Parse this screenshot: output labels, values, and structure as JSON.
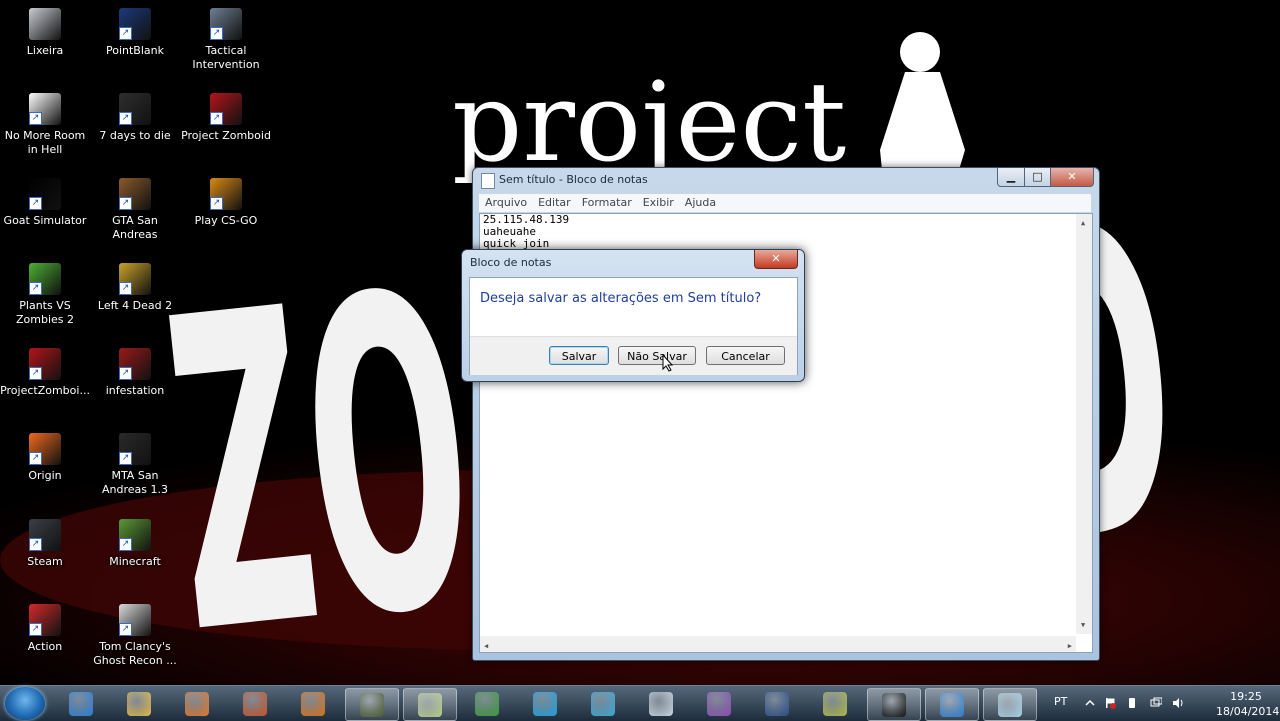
{
  "wallpaper": {
    "logo_top": "project",
    "logo_big": "ZOMBOID"
  },
  "desktop_icons": [
    {
      "label": "Lixeira",
      "icon": "recycle-bin-icon",
      "color": "#c8ccd2"
    },
    {
      "label": "PointBlank",
      "icon": "pointblank-icon",
      "color": "#1d3a7a"
    },
    {
      "label": "Tactical Intervention",
      "icon": "tactical-intervention-icon",
      "color": "#6d7f94"
    },
    {
      "label": "No More Room in Hell",
      "icon": "document-icon",
      "color": "#ffffff"
    },
    {
      "label": "7 days to die",
      "icon": "steam-game-icon",
      "color": "#2e2e2e"
    },
    {
      "label": "Project Zomboid",
      "icon": "project-zomboid-icon",
      "color": "#b3151a"
    },
    {
      "label": "Goat Simulator",
      "icon": "goat-simulator-icon",
      "color": "#000000"
    },
    {
      "label": "GTA San Andreas",
      "icon": "gta-icon",
      "color": "#8a5a2a"
    },
    {
      "label": "Play CS-GO",
      "icon": "csgo-icon",
      "color": "#d88a16"
    },
    {
      "label": "Plants VS Zombies 2",
      "icon": "bluestacks-icon",
      "color": "#4caf34"
    },
    {
      "label": "Left 4 Dead 2",
      "icon": "left4dead-icon",
      "color": "#c9a22a"
    },
    {
      "label": "ProjectZomboi...",
      "icon": "project-zomboid-icon",
      "color": "#b3151a"
    },
    {
      "label": "infestation",
      "icon": "infestation-icon",
      "color": "#9a1a1a"
    },
    {
      "label": "Origin",
      "icon": "origin-icon",
      "color": "#f06a1e"
    },
    {
      "label": "MTA San Andreas 1.3",
      "icon": "mta-icon",
      "color": "#2a2a2a"
    },
    {
      "label": "Steam",
      "icon": "steam-icon",
      "color": "#3a3f46"
    },
    {
      "label": "Minecraft",
      "icon": "minecraft-icon",
      "color": "#5a9a35"
    },
    {
      "label": "Action",
      "icon": "action-icon",
      "color": "#d12b2b"
    },
    {
      "label": "Tom Clancy's Ghost Recon ...",
      "icon": "ghost-recon-icon",
      "color": "#d9d9d9"
    }
  ],
  "notepad": {
    "title": "Sem título - Bloco de notas",
    "menu": [
      "Arquivo",
      "Editar",
      "Formatar",
      "Exibir",
      "Ajuda"
    ],
    "lines": [
      "25.115.48.139",
      "uaheuahe",
      "quick join"
    ],
    "min_glyph": "▁",
    "max_glyph": "□",
    "close_glyph": "✕"
  },
  "dialog": {
    "title": "Bloco de notas",
    "message": "Deseja salvar as alterações em Sem título?",
    "buttons": {
      "save": "Salvar",
      "dont_save": "Não Salvar",
      "cancel": "Cancelar"
    },
    "close_glyph": "✕"
  },
  "taskbar": {
    "items": [
      {
        "name": "internet-explorer",
        "color": "#2b7fd8",
        "active": false
      },
      {
        "name": "file-explorer",
        "color": "#e2b94a",
        "active": false
      },
      {
        "name": "media-player",
        "color": "#e0782b",
        "active": false
      },
      {
        "name": "winrar",
        "color": "#c8542a",
        "active": false
      },
      {
        "name": "ultrasurf",
        "color": "#d9731c",
        "active": false
      },
      {
        "name": "project-zomboid-task",
        "color": "#4a5a30",
        "active": true
      },
      {
        "name": "notepad-task",
        "color": "#b9cf8a",
        "active": true
      },
      {
        "name": "chrome",
        "color": "#3c9a3c",
        "active": false
      },
      {
        "name": "skype",
        "color": "#1fa1e0",
        "active": false
      },
      {
        "name": "media-center",
        "color": "#3aa8d8",
        "active": false
      },
      {
        "name": "utorrent-app",
        "color": "#c9d6e2",
        "active": false
      },
      {
        "name": "bittorrent",
        "color": "#8a4fb5",
        "active": false
      },
      {
        "name": "photoshop",
        "color": "#2a4f8a",
        "active": false
      },
      {
        "name": "system-monitor",
        "color": "#b0b84a",
        "active": false
      },
      {
        "name": "command-prompt",
        "color": "#111111",
        "active": true
      },
      {
        "name": "network-app",
        "color": "#2f7fd0",
        "active": true
      },
      {
        "name": "notepad-task-2",
        "color": "#a9d1e8",
        "active": true
      }
    ],
    "lang": "PT",
    "time": "19:25",
    "date": "18/04/2014"
  }
}
